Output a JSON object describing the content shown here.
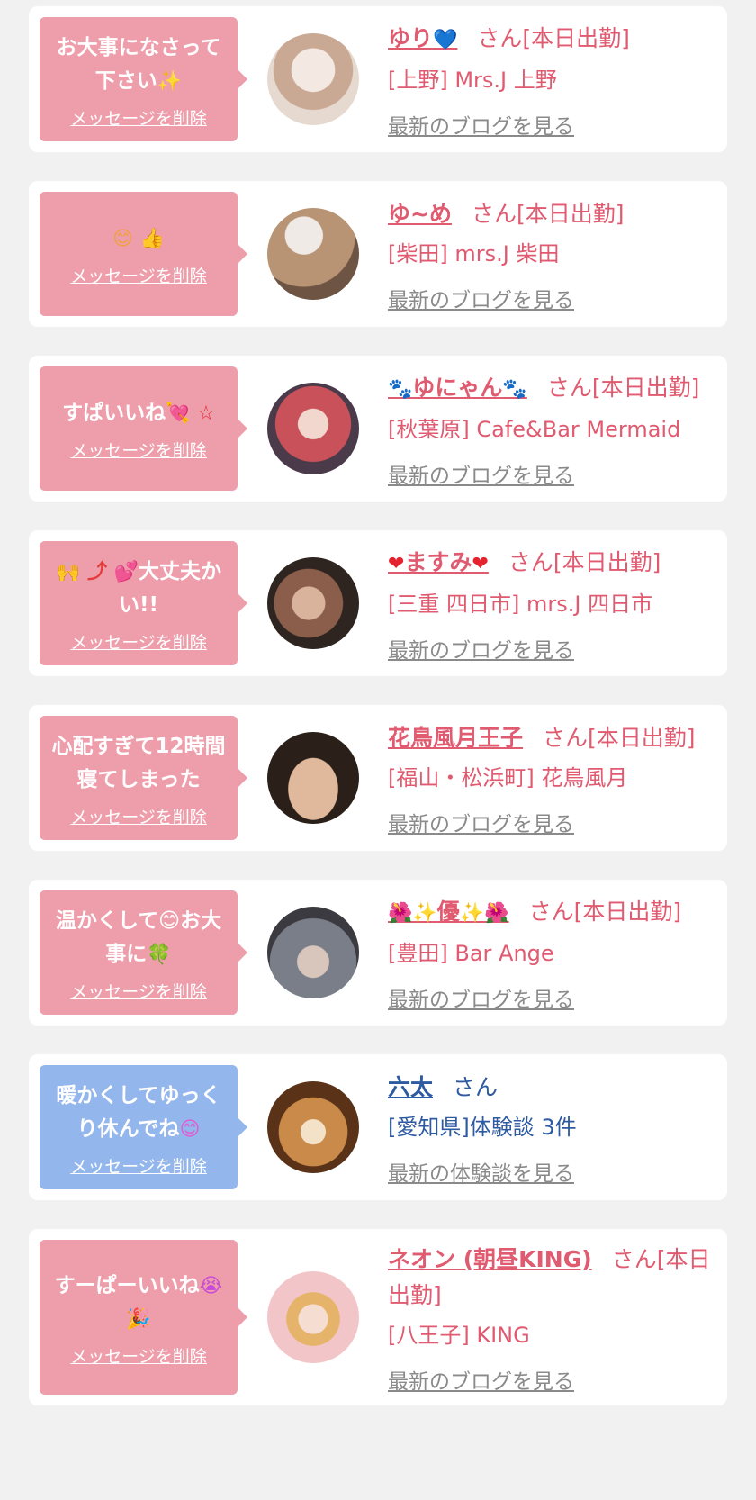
{
  "delete_label": "メッセージを削除",
  "cards": [
    {
      "bubble_color": "#ee9eab",
      "message": "お大事になさって下さい",
      "message_icon": "✨",
      "name_prefix_icon": "",
      "name": "ゆり",
      "name_suffix_icon": "💙",
      "suffix": "さん[本日出勤]",
      "shop": "[上野] Mrs.J 上野",
      "link": "最新のブログを見る",
      "avatar_colors": [
        "#e8dcd2",
        "#b89b88"
      ]
    },
    {
      "bubble_color": "#ee9eab",
      "message": "",
      "message_icon": "😊 👍",
      "name_prefix_icon": "",
      "name": "ゆ~め",
      "name_suffix_icon": "",
      "suffix": "さん[本日出勤]",
      "shop": "[柴田] mrs.J 柴田",
      "link": "最新のブログを見る",
      "avatar_colors": [
        "#c9ad95",
        "#6a5342"
      ]
    },
    {
      "bubble_color": "#ee9eab",
      "message": "すぱいいね",
      "message_icon": "💘 ☆",
      "name_prefix_icon": "🐾",
      "name": "ゆにゃん",
      "name_suffix_icon": "🐾",
      "suffix": "さん[本日出勤]",
      "shop": "[秋葉原] Cafe&Bar Mermaid",
      "link": "最新のブログを見る",
      "avatar_colors": [
        "#d08a8a",
        "#4a3a4a"
      ]
    },
    {
      "bubble_color": "#ee9eab",
      "message": "大丈夫かい!!",
      "message_icon": "🙌 ⤴ 💕",
      "name_prefix_icon": "❤",
      "name": "ますみ",
      "name_suffix_icon": "❤",
      "suffix": "さん[本日出勤]",
      "shop": "[三重 四日市] mrs.J 四日市",
      "link": "最新のブログを見る",
      "avatar_colors": [
        "#caa48a",
        "#3d2a22"
      ]
    },
    {
      "bubble_color": "#ee9eab",
      "message": "心配すぎて12時間寝てしまった",
      "message_icon": "",
      "name_prefix_icon": "",
      "name": "花鳥風月王子",
      "name_suffix_icon": "",
      "suffix": "さん[本日出勤]",
      "shop": "[福山・松浜町] 花鳥風月",
      "link": "最新のブログを見る",
      "avatar_colors": [
        "#d9b296",
        "#2b2019"
      ]
    },
    {
      "bubble_color": "#ee9eab",
      "message": "温かくして😊お大事に",
      "message_icon": "🍀",
      "name_prefix_icon": "🌺✨",
      "name": "優",
      "name_suffix_icon": "✨🌺",
      "suffix": "さん[本日出勤]",
      "shop": "[豊田] Bar Ange",
      "link": "最新のブログを見る",
      "avatar_colors": [
        "#9a9ea8",
        "#3a3a40"
      ]
    },
    {
      "bubble_color": "#93b6ec",
      "message": "暖かくしてゆっくり休んでね",
      "message_icon": "😊",
      "name_prefix_icon": "",
      "name": "六太",
      "name_suffix_icon": "",
      "suffix": "さん",
      "shop": "[愛知県]体験談 3件",
      "link": "最新の体験談を見る",
      "avatar_colors": [
        "#c98a4a",
        "#5a3218"
      ]
    },
    {
      "bubble_color": "#ee9eab",
      "message": "すーぱーいいね",
      "message_icon": "😭 🎉",
      "name_prefix_icon": "",
      "name": "ネオン (朝昼KING)",
      "name_suffix_icon": "",
      "suffix": "さん[本日出勤]",
      "shop": "[八王子] KING",
      "link": "最新のブログを見る",
      "avatar_colors": [
        "#f2c6c8",
        "#e08a92"
      ]
    }
  ]
}
